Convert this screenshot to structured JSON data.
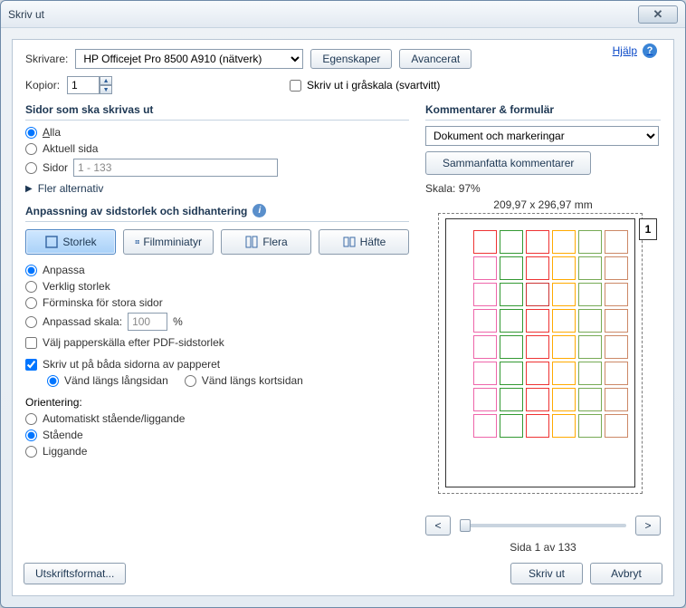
{
  "window": {
    "title": "Skriv ut"
  },
  "header": {
    "help": "Hjälp"
  },
  "printer": {
    "label": "Skrivare:",
    "value": "HP Officejet Pro 8500 A910 (nätverk)",
    "properties": "Egenskaper",
    "advanced": "Avancerat"
  },
  "copies": {
    "label": "Kopior:",
    "value": "1",
    "grayscale": "Skriv ut i gråskala (svartvitt)"
  },
  "pages": {
    "title": "Sidor som ska skrivas ut",
    "all_u": "A",
    "all_rest": "lla",
    "current": "Aktuell sida",
    "range": "Sidor",
    "range_value": "1 - 133",
    "more": "Fler alternativ"
  },
  "sizing": {
    "title": "Anpassning av sidstorlek och sidhantering",
    "tabs": [
      "Storlek",
      "Filmminiatyr",
      "Flera",
      "Häfte"
    ],
    "fit": "Anpassa",
    "actual": "Verklig storlek",
    "shrink": "Förminska för stora sidor",
    "custom": "Anpassad skala:",
    "custom_value": "100",
    "paper_source": "Välj papperskälla efter PDF-sidstorlek"
  },
  "duplex": {
    "label": "Skriv ut på båda sidorna av papperet",
    "long": "Vänd längs långsidan",
    "short": "Vänd längs kortsidan"
  },
  "orientation": {
    "label": "Orientering:",
    "auto": "Automatiskt stående/liggande",
    "portrait": "Stående",
    "landscape": "Liggande"
  },
  "comments": {
    "title": "Kommentarer & formulär",
    "value": "Dokument och markeringar",
    "summarize": "Sammanfatta kommentarer"
  },
  "preview": {
    "scale_label": "Skala:",
    "scale_value": "97%",
    "dimensions": "209,97 x 296,97 mm",
    "page_number": "1",
    "page_of": "Sida 1 av 133",
    "icon_colors": [
      "#e33",
      "#393",
      "#e33",
      "#fa0",
      "#7a5",
      "#c86",
      "#e6a",
      "#393",
      "#e33",
      "#fa0",
      "#7a5",
      "#c86",
      "#e6a",
      "#393",
      "#c33",
      "#fa0",
      "#7a5",
      "#c86",
      "#e6a",
      "#393",
      "#e33",
      "#fa0",
      "#7a5",
      "#c86",
      "#e6a",
      "#393",
      "#e33",
      "#fa0",
      "#7a5",
      "#c86",
      "#e6a",
      "#393",
      "#e33",
      "#fa0",
      "#7a5",
      "#c86",
      "#e6a",
      "#393",
      "#e33",
      "#fa0",
      "#7a5",
      "#c86",
      "#e6a",
      "#393",
      "#e33",
      "#fa0",
      "#7a5",
      "#c86"
    ]
  },
  "footer": {
    "page_setup": "Utskriftsformat...",
    "print": "Skriv ut",
    "cancel": "Avbryt"
  }
}
